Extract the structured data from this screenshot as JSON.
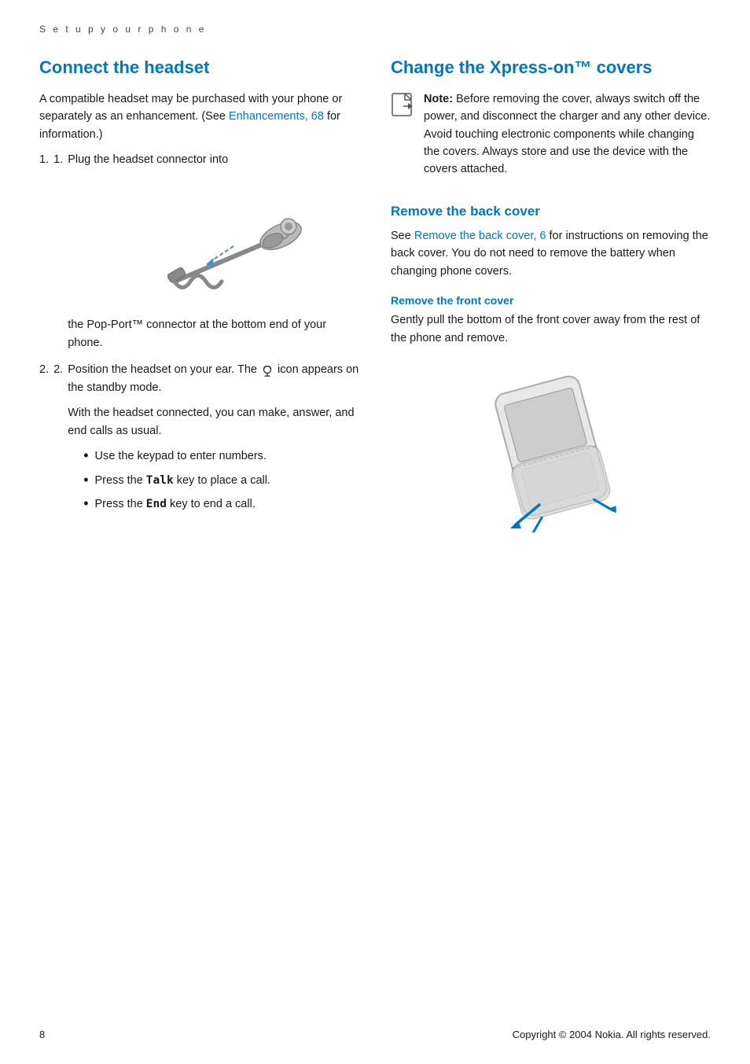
{
  "breadcrumb": "S e t   u p   y o u r   p h o n e",
  "left": {
    "title": "Connect the headset",
    "intro": "A compatible headset may be purchased with your phone or separately as an enhancement. (See ",
    "link_text": "Enhancements, 68",
    "intro_end": " for information.)",
    "steps": [
      {
        "text_before": "Plug the headset connector into",
        "text_after": "the Pop-Port™ connector at the bottom end of your phone."
      },
      {
        "text_main": "Position the headset on your ear. The",
        "text_icon": "🔔",
        "text_after": " icon appears on the standby mode.",
        "extra": "With the headset connected, you can make, answer, and end calls as usual."
      }
    ],
    "bullets": [
      "Use the keypad to enter numbers.",
      {
        "text_before": "Press the ",
        "bold": "Talk",
        "text_after": " key to place a call."
      },
      {
        "text_before": "Press the ",
        "bold": "End",
        "text_after": " key to end a call."
      }
    ]
  },
  "right": {
    "title_main": "Change the Xpress-on™ covers",
    "note_label": "Note:",
    "note_text": " Before removing the cover, always switch off the power, and disconnect the charger and any other device. Avoid touching electronic components while changing the covers. Always store and use the device with the covers attached.",
    "remove_back_title": "Remove the back cover",
    "remove_back_link": "Remove the back cover, 6",
    "remove_back_text": " for instructions on removing the back cover. You do not need to remove the battery when changing phone covers.",
    "remove_back_intro": "See ",
    "remove_front_title": "Remove the front cover",
    "remove_front_text": "Gently pull the bottom of the front cover away from the rest of the phone and remove."
  },
  "footer": {
    "page_number": "8",
    "copyright": "Copyright © 2004 Nokia. All rights reserved."
  }
}
